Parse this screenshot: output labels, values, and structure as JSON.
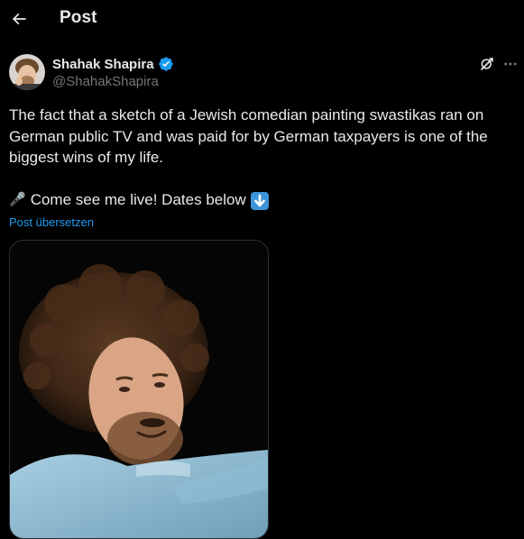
{
  "header": {
    "title": "Post",
    "back_icon": "arrow-left-icon"
  },
  "author": {
    "display_name": "Shahak Shapira",
    "handle": "@ShahakShapira",
    "verified": true,
    "verified_color": "#1d9bf0"
  },
  "actions": {
    "grok_icon": "grok-icon",
    "more_icon": "more-icon"
  },
  "tweet": {
    "text": "The fact that a sketch of a Jewish comedian painting swastikas ran on German public TV and was paid for by German taxpayers is one of the biggest wins of my life.",
    "cta_emoji": "🎤",
    "cta_text": "Come see me live! Dates below",
    "cta_arrow_emoji": "⬇️",
    "translate_label": "Post übersetzen"
  },
  "colors": {
    "background": "#000000",
    "text": "#e7e9ea",
    "secondary": "#71767b",
    "link": "#1d9bf0",
    "border": "#2f3336"
  }
}
